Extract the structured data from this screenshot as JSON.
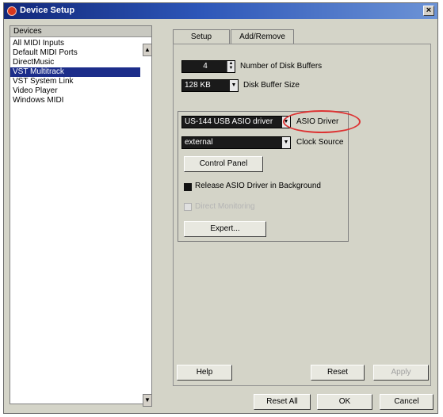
{
  "window": {
    "title": "Device Setup",
    "close_label": "×"
  },
  "devices": {
    "header": "Devices",
    "items": [
      "All MIDI Inputs",
      "Default MIDI Ports",
      "DirectMusic",
      "VST Multitrack",
      "VST System Link",
      "Video Player",
      "Windows MIDI"
    ],
    "selected": "VST Multitrack"
  },
  "tabs": [
    {
      "label": "Setup"
    },
    {
      "label": "Add/Remove"
    }
  ],
  "setup": {
    "disk_buffers": {
      "value": "4",
      "label": "Number of Disk Buffers"
    },
    "buffer_size": {
      "value": "128 KB",
      "label": "Disk Buffer Size"
    },
    "asio_driver": {
      "value": "US-144 USB ASIO driver",
      "label": "ASIO Driver"
    },
    "clock_source": {
      "value": "external",
      "label": "Clock Source"
    },
    "control_panel": "Control Panel",
    "release_asio": {
      "label": "Release ASIO Driver in Background",
      "checked": true
    },
    "direct_monitoring": {
      "label": "Direct Monitoring",
      "checked": false,
      "disabled": true
    },
    "expert": "Expert..."
  },
  "buttons": {
    "help": "Help",
    "reset": "Reset",
    "apply": "Apply",
    "reset_all": "Reset All",
    "ok": "OK",
    "cancel": "Cancel"
  },
  "colors": {
    "title_bar": "#2d56b8",
    "selection": "#1c2d8a",
    "annotation_ring": "#dd3333"
  },
  "icons": {
    "title": "cubase-logo-icon",
    "close": "close-icon",
    "spin": "spin-arrows-icon",
    "dropdown": "chevron-down-icon",
    "scroll_up": "scroll-up-icon",
    "scroll_down": "scroll-down-icon"
  }
}
